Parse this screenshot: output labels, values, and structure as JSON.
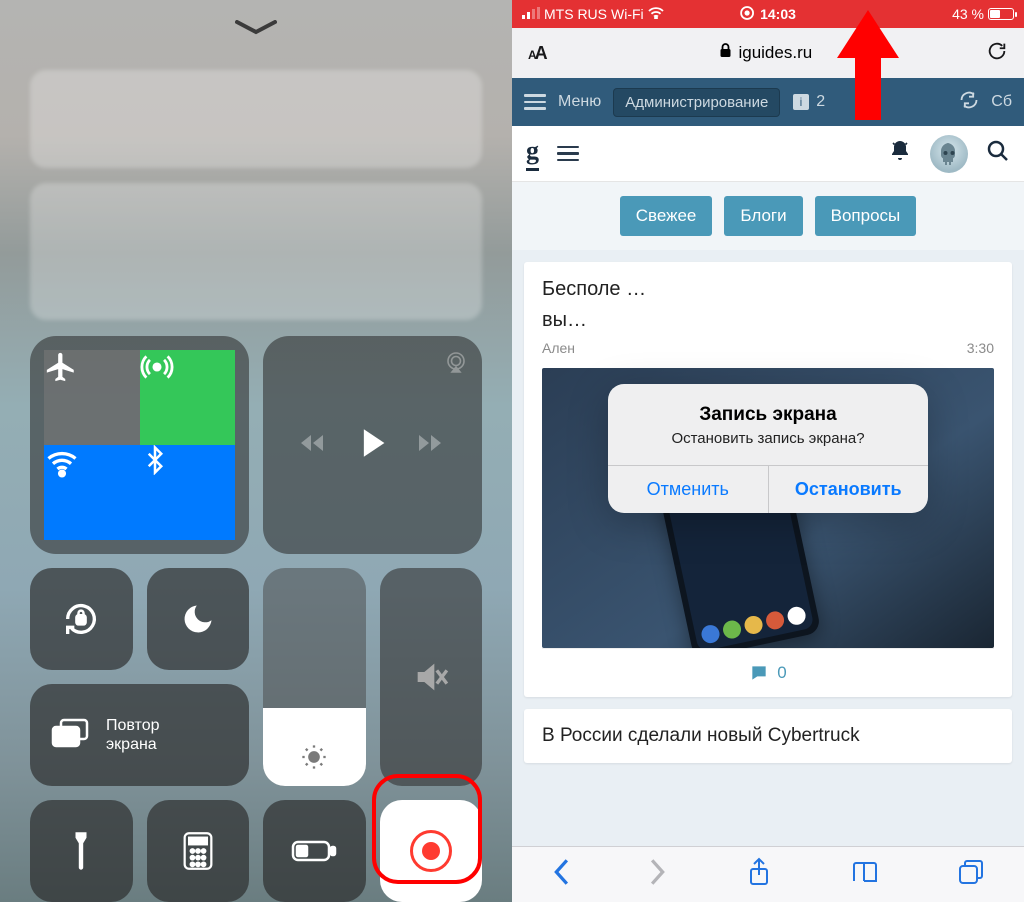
{
  "left": {
    "screen_mirror_label": "Повтор\nэкрана"
  },
  "right": {
    "status": {
      "carrier": "MTS RUS",
      "net": "Wi-Fi",
      "time": "14:03",
      "battery": "43 %"
    },
    "addr": {
      "text_size": "AA",
      "url": "iguides.ru"
    },
    "site_bar": {
      "menu": "Меню",
      "admin": "Администрирование",
      "badge": "2",
      "refresh_partial": "Сб"
    },
    "tabs": {
      "t1": "Свежее",
      "t2": "Блоги",
      "t3": "Вопросы"
    },
    "article1": {
      "title_partial": "Бесп",
      "subtitle_partial": "вы",
      "author_partial": "Ален",
      "time": "3:30",
      "comments": "0"
    },
    "article2": {
      "title_partial": "В России сделали новый Cybertruck"
    },
    "alert": {
      "title": "Запись экрана",
      "message": "Остановить запись экрана?",
      "cancel": "Отменить",
      "stop": "Остановить"
    }
  }
}
